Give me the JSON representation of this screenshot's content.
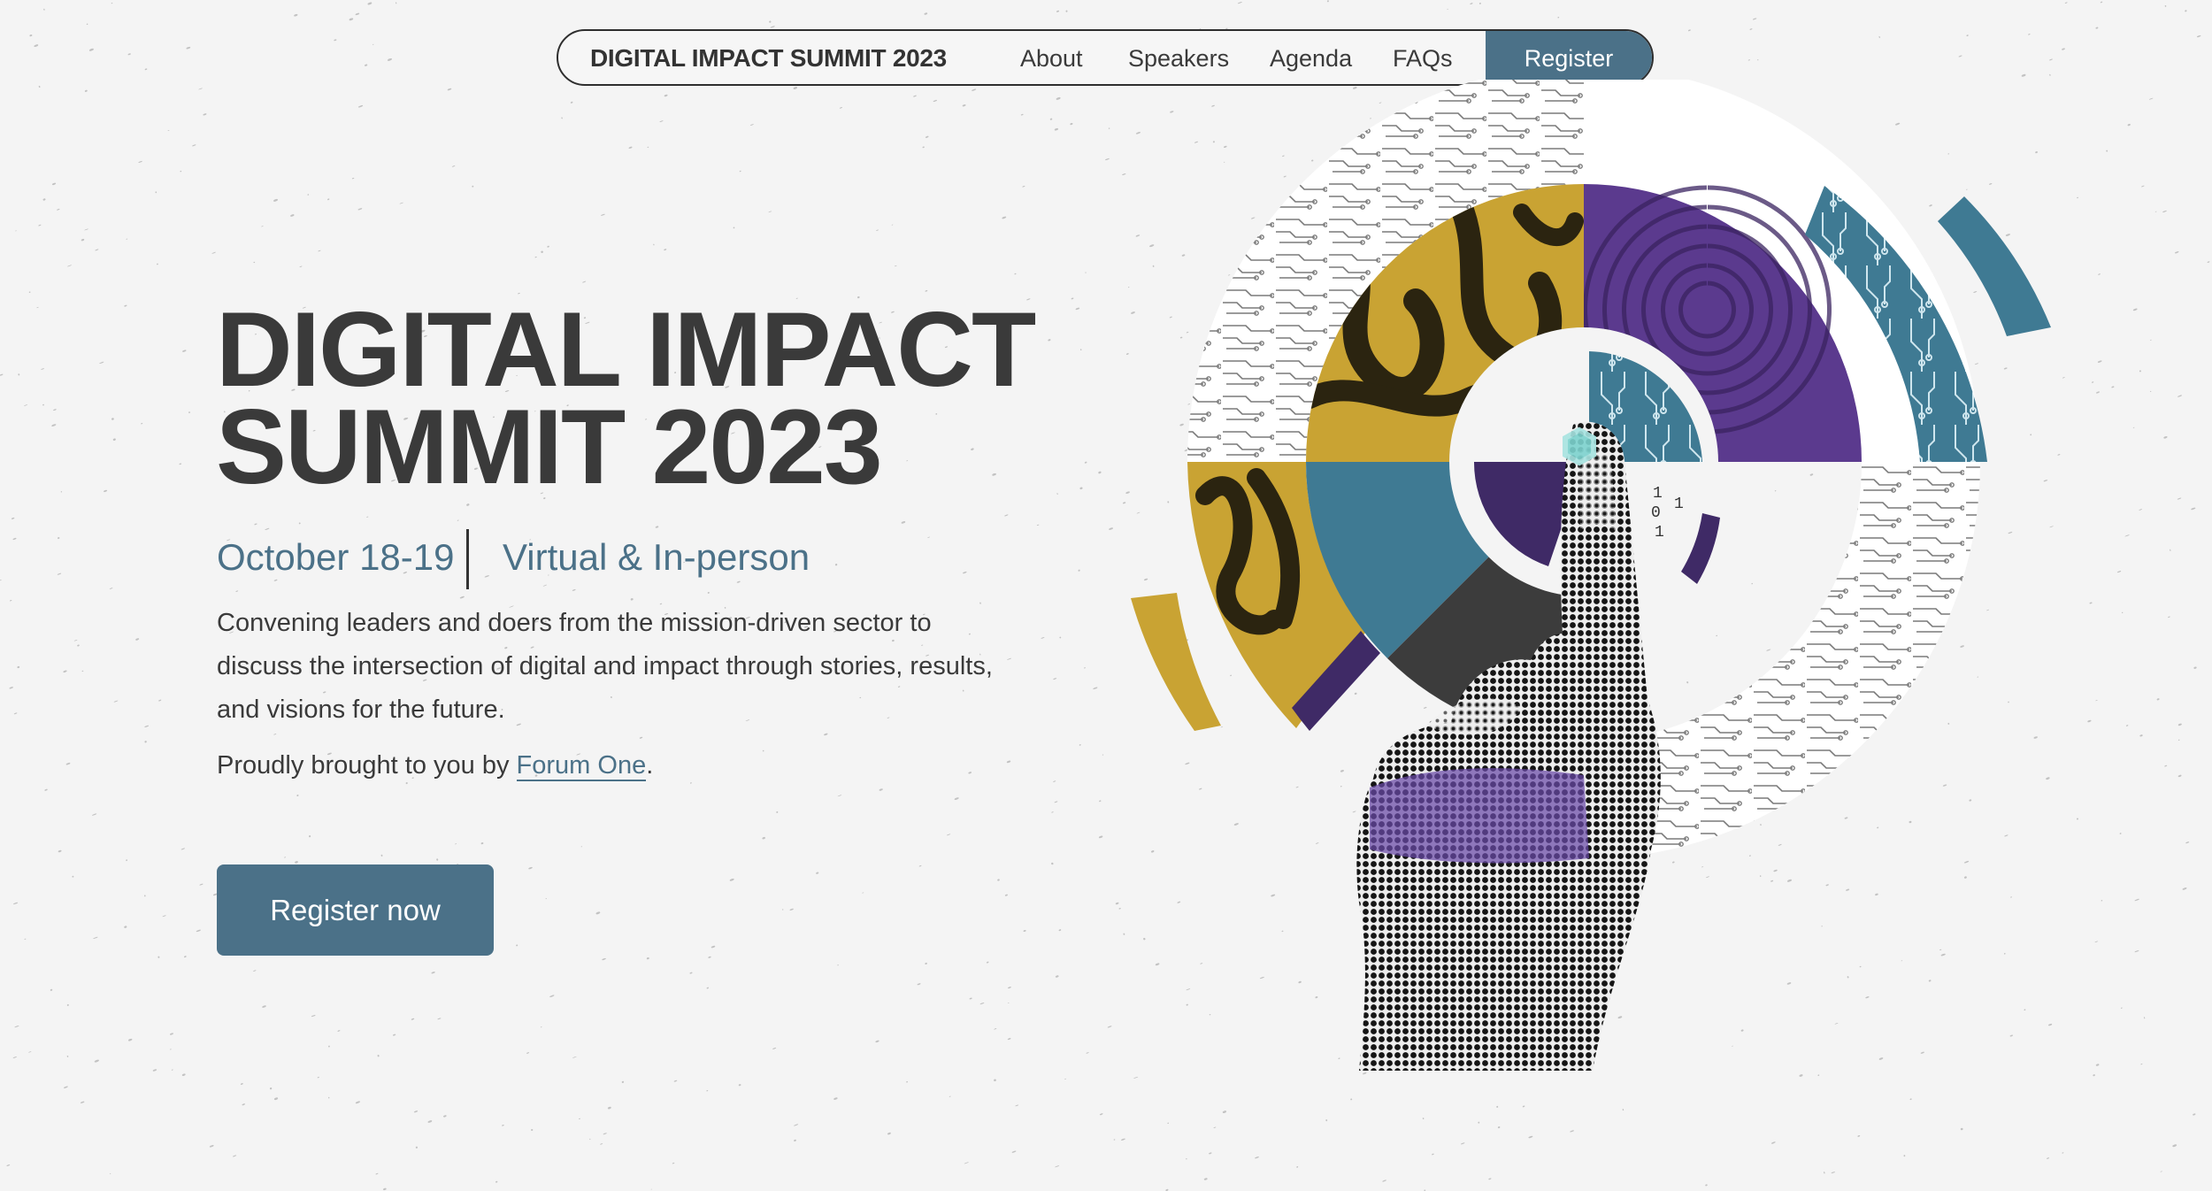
{
  "nav": {
    "brand": "DIGITAL IMPACT SUMMIT 2023",
    "links": [
      "About",
      "Speakers",
      "Agenda",
      "FAQs"
    ],
    "register_label": "Register"
  },
  "hero": {
    "title_line1": "DIGITAL IMPACT",
    "title_line2": "SUMMIT 2023",
    "date": "October 18-19",
    "format": "Virtual & In-person",
    "description": "Convening leaders and doers from the mission-driven sector to discuss the intersection of digital and impact through stories, results, and visions for the future.",
    "credit_prefix": "Proudly brought to you by ",
    "credit_link": "Forum One",
    "credit_suffix": ".",
    "cta_label": "Register now"
  },
  "art": {
    "binary_digits": [
      "1",
      "0",
      "1",
      "1"
    ]
  },
  "colors": {
    "accent": "#4b7188",
    "mustard": "#c9a333",
    "purple": "#5b3a8e",
    "deep_purple": "#3f2a66",
    "teal": "#3f7a93",
    "dark_gray": "#3c3c3c",
    "background": "#f4f4f4"
  }
}
